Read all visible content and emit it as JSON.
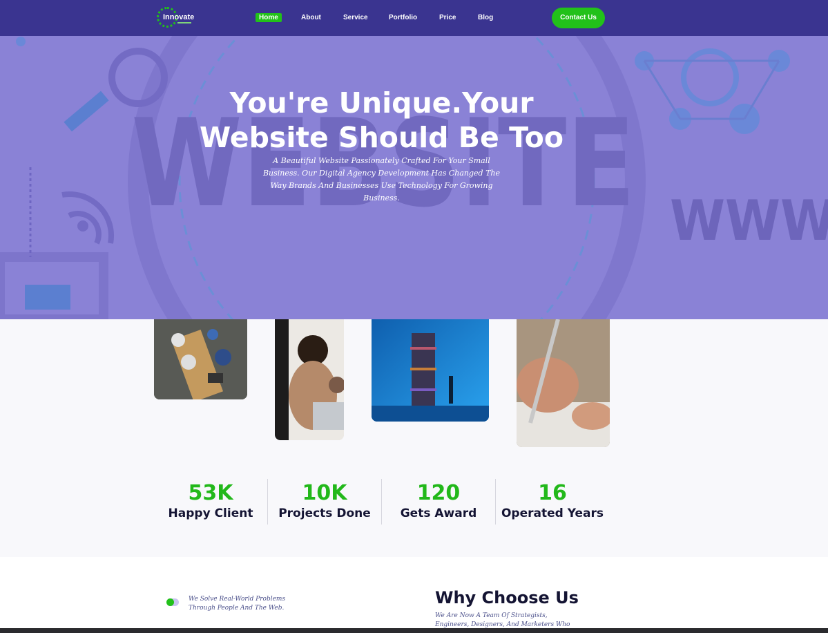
{
  "brand": {
    "name": "Innovate",
    "green": "#22c11a",
    "nav_bg": "#3a3490",
    "hero_bg": "#8a82d6"
  },
  "nav": {
    "items": [
      {
        "label": "Home",
        "active": true
      },
      {
        "label": "About",
        "active": false
      },
      {
        "label": "Service",
        "active": false
      },
      {
        "label": "Portfolio",
        "active": false
      },
      {
        "label": "Price",
        "active": false
      },
      {
        "label": "Blog",
        "active": false
      }
    ],
    "contact_label": "Contact Us"
  },
  "hero": {
    "title_line1": "You're Unique.Your",
    "title_line2": "Website Should Be Too",
    "subtitle": "A Beautiful Website Passionately Crafted For Your Small Business. Our Digital Agency Development Has Changed The Way Brands And Businesses Use Technology For Growing Business.",
    "bg_word_1": "WEBSITE",
    "bg_word_2": "WWW"
  },
  "gallery": [
    {
      "name": "team-meeting-photo"
    },
    {
      "name": "women-laptop-photo"
    },
    {
      "name": "book-tower-photo"
    },
    {
      "name": "hand-writing-photo"
    }
  ],
  "stats": [
    {
      "value": "53K",
      "label": "Happy Client"
    },
    {
      "value": "10K",
      "label": "Projects Done"
    },
    {
      "value": "120",
      "label": "Gets Award"
    },
    {
      "value": "16",
      "label": "Operated Years"
    }
  ],
  "why": {
    "tagline": "We Solve Real-World Problems Through People And The Web.",
    "title": "Why Choose Us",
    "text": "We Are Now A Team Of Strategists, Engineers, Designers, And Marketers Who"
  }
}
